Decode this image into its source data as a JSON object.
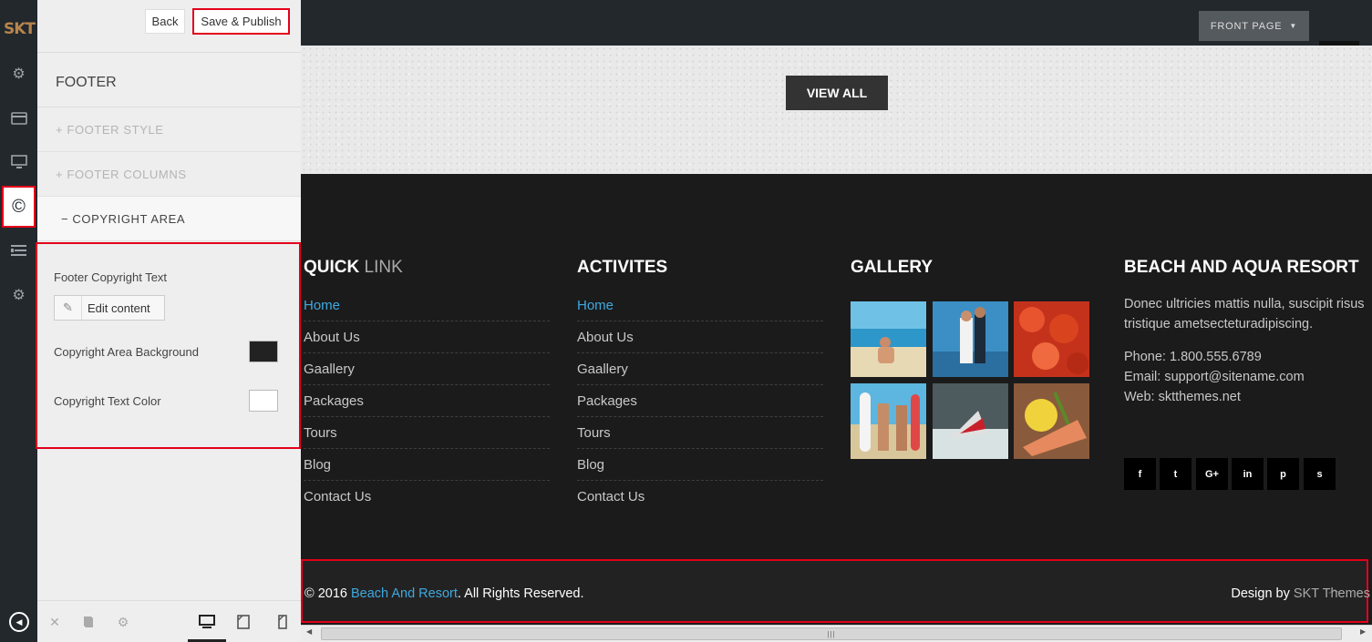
{
  "rail": {
    "logo": "SKT"
  },
  "panel": {
    "back_label": "Back",
    "publish_label": "Save & Publish",
    "section_title": "FOOTER",
    "accordion": [
      {
        "label": "+ FOOTER STYLE"
      },
      {
        "label": "+ FOOTER COLUMNS"
      },
      {
        "label": "− COPYRIGHT AREA"
      }
    ],
    "copyright_text_label": "Footer Copyright Text",
    "edit_content_label": "Edit content",
    "bg_label": "Copyright Area Background",
    "bg_color": "#222222",
    "text_color_label": "Copyright Text Color",
    "text_color": "#ffffff"
  },
  "preview": {
    "front_page_label": "FRONT PAGE",
    "view_all_label": "VIEW ALL",
    "quick_link": {
      "title_bold": "QUICK",
      "title_light": " LINK",
      "items": [
        "Home",
        "About Us",
        "Gaallery",
        "Packages",
        "Tours",
        "Blog",
        "Contact Us"
      ]
    },
    "activities": {
      "title": "ACTIVITES",
      "items": [
        "Home",
        "About Us",
        "Gaallery",
        "Packages",
        "Tours",
        "Blog",
        "Contact Us"
      ]
    },
    "gallery": {
      "title": "GALLERY"
    },
    "resort": {
      "title": "BEACH AND AQUA RESORT",
      "description": "Donec ultricies mattis nulla, suscipit risus tristique ametsecteturadipiscing.",
      "phone": "Phone: 1.800.555.6789",
      "email": "Email: support@sitename.com",
      "web": "Web: sktthemes.net"
    },
    "social": [
      "f",
      "t",
      "G+",
      "in",
      "p",
      "s"
    ],
    "copyright": {
      "prefix": "© 2016 ",
      "link": "Beach And Resort",
      "suffix": ". All Rights Reserved.",
      "design_prefix": "Design by ",
      "design_link": "SKT Themes"
    }
  },
  "colors": {
    "accent_red": "#e3001b",
    "link_blue": "#3fa9df",
    "footer_bg": "#1b1b1b"
  }
}
